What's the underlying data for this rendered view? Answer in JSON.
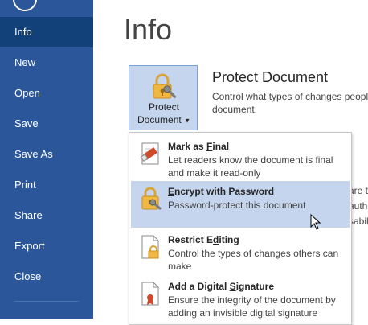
{
  "sidebar": {
    "items": [
      {
        "label": "Info",
        "active": true
      },
      {
        "label": "New"
      },
      {
        "label": "Open"
      },
      {
        "label": "Save"
      },
      {
        "label": "Save As"
      },
      {
        "label": "Print"
      },
      {
        "label": "Share"
      },
      {
        "label": "Export"
      },
      {
        "label": "Close"
      }
    ]
  },
  "main": {
    "title": "Info",
    "protect_button": {
      "line1": "Protect",
      "line2": "Document"
    },
    "protect_section": {
      "title": "Protect Document",
      "description": "Control what types of changes peopl document."
    },
    "background_fragments": [
      "are to",
      "autho",
      "sabil"
    ]
  },
  "menu": {
    "items": [
      {
        "title_pre": "Mark as ",
        "title_u": "F",
        "title_post": "inal",
        "desc": "Let readers know the document is final and make it read-only",
        "icon": "mark-final-icon"
      },
      {
        "title_pre": "",
        "title_u": "E",
        "title_post": "ncrypt with Password",
        "desc": "Password-protect this document",
        "icon": "lock-key-icon",
        "hover": true
      },
      {
        "title_pre": "Restrict E",
        "title_u": "d",
        "title_post": "iting",
        "desc": "Control the types of changes others can make",
        "icon": "restrict-editing-icon"
      },
      {
        "title_pre": "Add a Digital ",
        "title_u": "S",
        "title_post": "ignature",
        "desc": "Ensure the integrity of the document by adding an invisible digital signature",
        "icon": "digital-signature-icon"
      }
    ]
  },
  "colors": {
    "sidebar": "#2b579a",
    "sidebar_active": "#124078",
    "hover": "#c5d5ee"
  }
}
